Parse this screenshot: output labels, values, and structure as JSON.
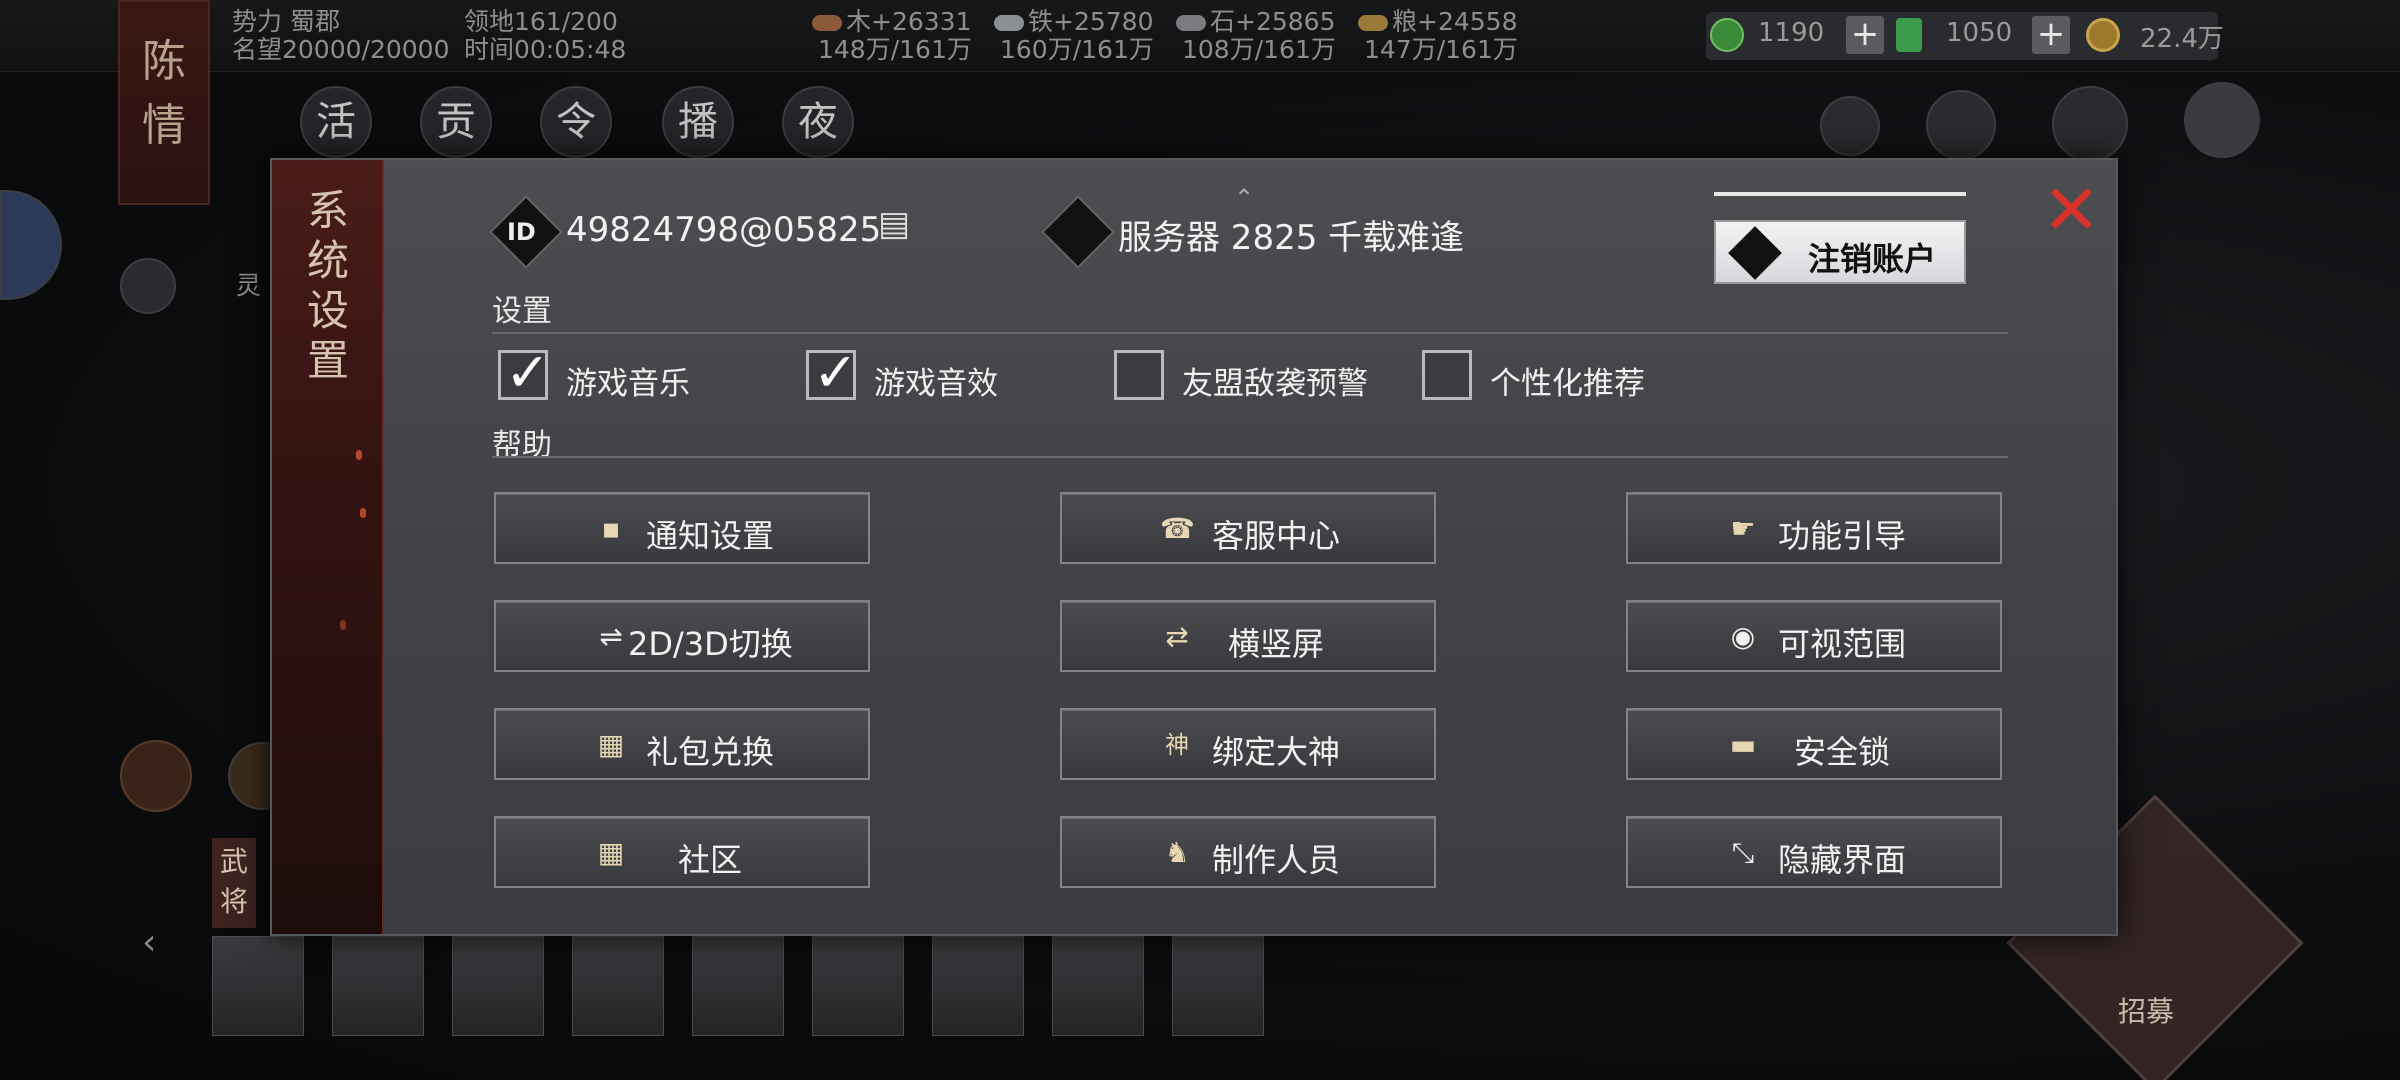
{
  "topbar": {
    "faction": "势力 蜀郡",
    "reputation": "名望20000/20000",
    "territory": "领地161/200",
    "time": "时间00:05:48",
    "resources": [
      {
        "name": "wood",
        "gain": "木+26331",
        "stock": "148万/161万",
        "color": "#8a5a3a"
      },
      {
        "name": "iron",
        "gain": "铁+25780",
        "stock": "160万/161万",
        "color": "#8c8f94"
      },
      {
        "name": "stone",
        "gain": "石+25865",
        "stock": "108万/161万",
        "color": "#7a7c80"
      },
      {
        "name": "grain",
        "gain": "粮+24558",
        "stock": "147万/161万",
        "color": "#9a7a3a"
      }
    ],
    "jade": "1190",
    "tokens": "1050",
    "copper": "22.4万",
    "plus": "+"
  },
  "background": {
    "banner_chars": [
      "陈",
      "情"
    ],
    "nav_items": [
      "活",
      "贡",
      "令",
      "播",
      "夜"
    ],
    "hero_tab": [
      "武",
      "将"
    ],
    "recruit_label": "招募",
    "side_label": "灵"
  },
  "dialog": {
    "title_chars": [
      "系",
      "统",
      "设",
      "置"
    ],
    "id_badge": "ID",
    "account_id": "49824798@05825",
    "server": "服务器 2825 千载难逢",
    "logout": "注销账户",
    "close": "✕",
    "settings_label": "设置",
    "help_label": "帮助",
    "checkboxes": [
      {
        "label": "游戏音乐",
        "checked": true
      },
      {
        "label": "游戏音效",
        "checked": true
      },
      {
        "label": "友盟敌袭预警",
        "checked": false
      },
      {
        "label": "个性化推荐",
        "checked": false
      }
    ],
    "buttons": [
      {
        "label": "通知设置",
        "icon": "speech-bubble-icon",
        "glyph": "▪"
      },
      {
        "label": "客服中心",
        "icon": "phone-icon",
        "glyph": "☎"
      },
      {
        "label": "功能引导",
        "icon": "pointing-hand-icon",
        "glyph": "☛"
      },
      {
        "label": "2D/3D切换",
        "icon": "swap-arrows-icon",
        "glyph": "⇌"
      },
      {
        "label": "横竖屏",
        "icon": "rotate-icon",
        "glyph": "⇄"
      },
      {
        "label": "可视范围",
        "icon": "eye-icon",
        "glyph": "◉"
      },
      {
        "label": "礼包兑换",
        "icon": "gift-icon",
        "glyph": "▦"
      },
      {
        "label": "绑定大神",
        "icon": "god-badge-icon",
        "glyph": "神"
      },
      {
        "label": "安全锁",
        "icon": "lock-icon",
        "glyph": "▬"
      },
      {
        "label": "社区",
        "icon": "gift-icon",
        "glyph": "▦"
      },
      {
        "label": "制作人员",
        "icon": "horse-icon",
        "glyph": "♞"
      },
      {
        "label": "隐藏界面",
        "icon": "resize-arrow-icon",
        "glyph": "⤡"
      }
    ]
  },
  "colors": {
    "close_red": "#d7332c",
    "panel_gray": "#45474b",
    "side_red": "#3a1512"
  }
}
